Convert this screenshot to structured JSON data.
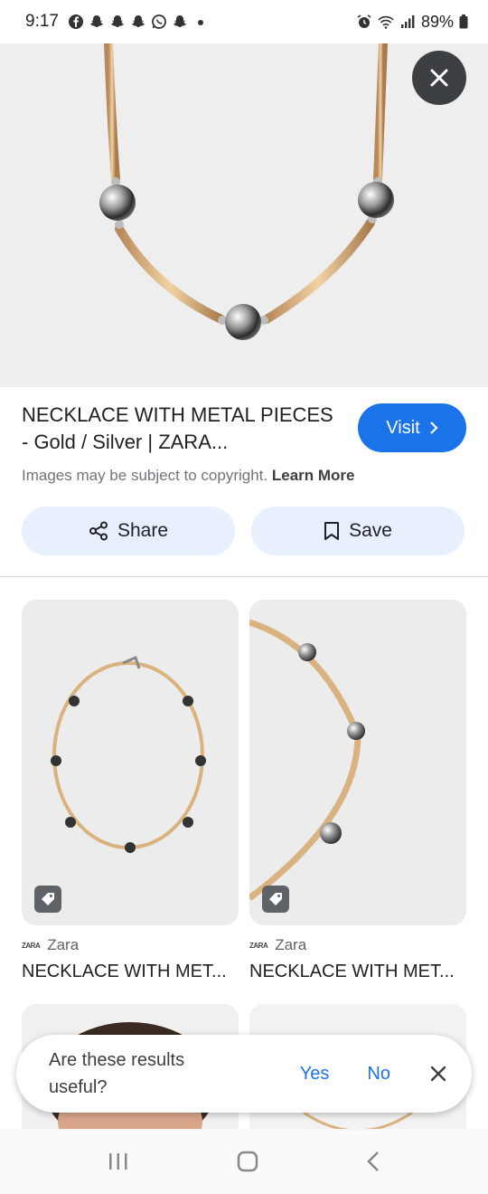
{
  "status_bar": {
    "time": "9:17",
    "battery": "89%",
    "icons": [
      "facebook-icon",
      "snapchat-icon",
      "snapchat-icon",
      "snapchat-icon",
      "whatsapp-icon",
      "snapchat-icon",
      "dot-icon"
    ],
    "right_icons": [
      "alarm-icon",
      "wifi-icon",
      "signal-icon",
      "battery-icon"
    ]
  },
  "detail": {
    "title": "NECKLACE WITH METAL PIECES - Gold / Silver | ZARA...",
    "visit_label": "Visit",
    "copyright_text": "Images may be subject to copyright.",
    "learn_more": "Learn More",
    "share_label": "Share",
    "save_label": "Save"
  },
  "results": [
    {
      "source": "Zara",
      "source_logo": "ZARA",
      "title": "NECKLACE WITH MET..."
    },
    {
      "source": "Zara",
      "source_logo": "ZARA",
      "title": "NECKLACE WITH MET..."
    }
  ],
  "feedback": {
    "question": "Are these results useful?",
    "yes": "Yes",
    "no": "No"
  },
  "colors": {
    "accent": "#1a73e8",
    "chip_bg": "#e8f0fe",
    "close_bg": "#3c4043"
  }
}
